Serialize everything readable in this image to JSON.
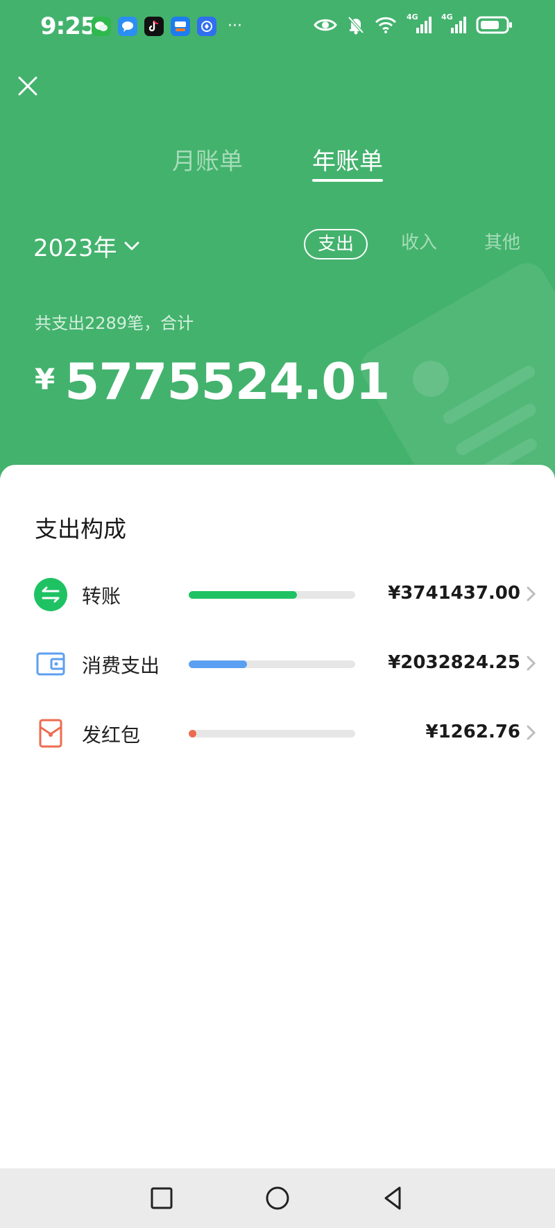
{
  "status_bar": {
    "time": "9:25",
    "app_icons": [
      "wechat-icon",
      "message-icon",
      "tiktok-icon",
      "yupao-icon",
      "browser-icon"
    ],
    "more": "···",
    "network": [
      "4G",
      "4G"
    ]
  },
  "tabs": [
    {
      "label": "月账单",
      "active": false
    },
    {
      "label": "年账单",
      "active": true
    }
  ],
  "year_selector": {
    "label": "2023年"
  },
  "filters": [
    {
      "label": "支出",
      "active": true
    },
    {
      "label": "收入",
      "active": false
    },
    {
      "label": "其他",
      "active": false
    }
  ],
  "summary": {
    "text": "共支出2289笔，合计",
    "currency": "¥",
    "total": "5775524.01"
  },
  "composition": {
    "title": "支出构成",
    "items": [
      {
        "label": "转账",
        "amount": "¥3741437.00",
        "share": 0.648,
        "color": "#1ec263",
        "icon": "transfer-icon"
      },
      {
        "label": "消费支出",
        "amount": "¥2032824.25",
        "share": 0.352,
        "color": "#5b9ff2",
        "icon": "wallet-icon"
      },
      {
        "label": "发红包",
        "amount": "¥1262.76",
        "share": 0.0002,
        "color": "#ed6b4e",
        "icon": "red-envelope-icon"
      }
    ]
  },
  "colors": {
    "header_bg": "#43b26d",
    "accent_green": "#1ec263"
  }
}
